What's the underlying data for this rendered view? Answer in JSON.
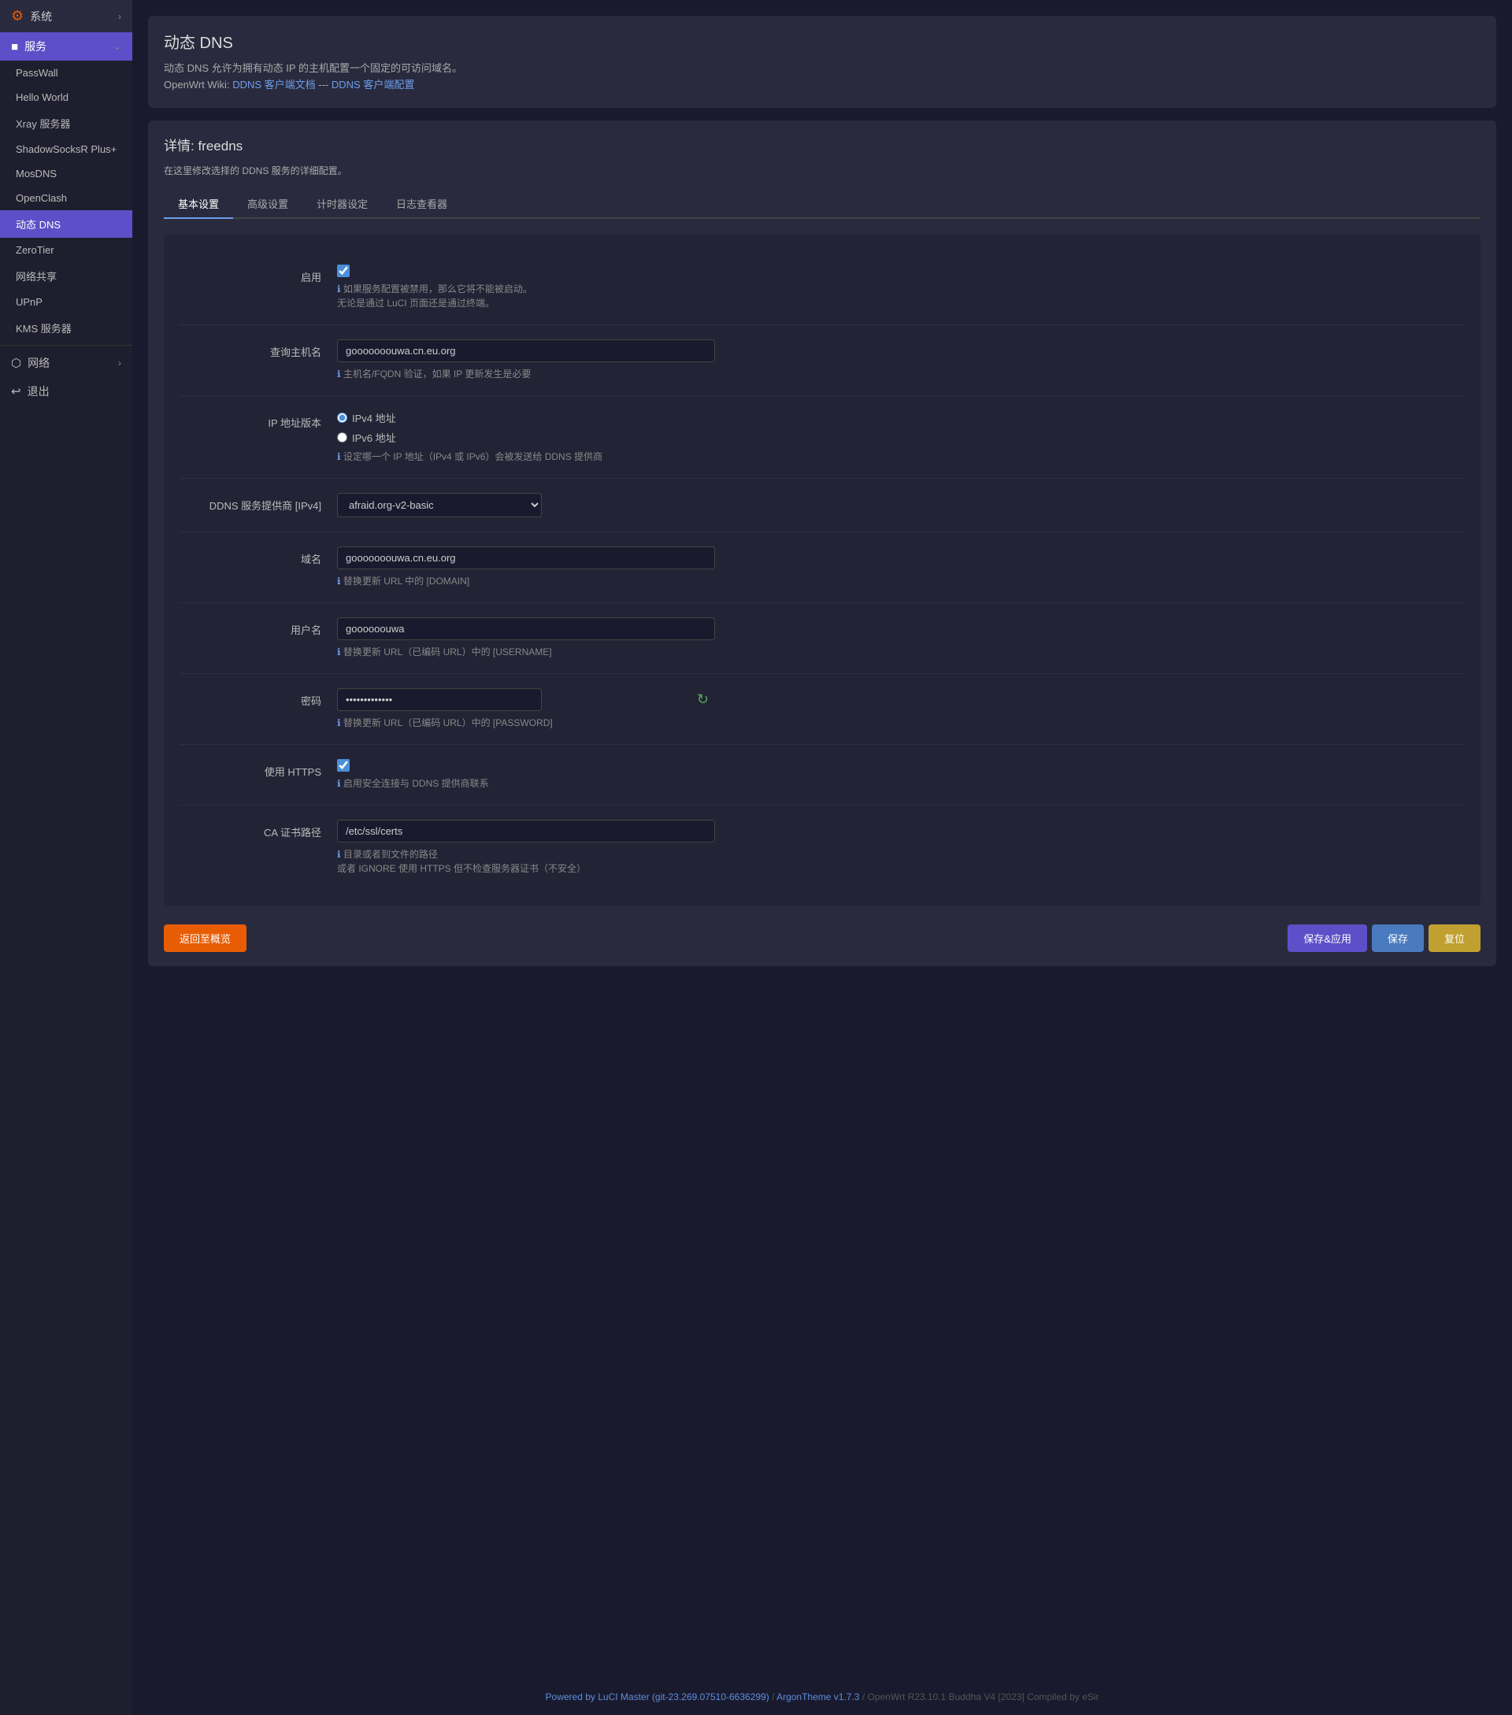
{
  "sidebar": {
    "system_label": "系统",
    "services_label": "服务",
    "network_label": "网络",
    "logout_label": "退出",
    "items": [
      {
        "id": "passwall",
        "label": "PassWall"
      },
      {
        "id": "hello-world",
        "label": "Hello World"
      },
      {
        "id": "xray",
        "label": "Xray 服务器"
      },
      {
        "id": "shadowsocks",
        "label": "ShadowSocksR Plus+"
      },
      {
        "id": "mosdns",
        "label": "MosDNS"
      },
      {
        "id": "openclash",
        "label": "OpenClash"
      },
      {
        "id": "ddns",
        "label": "动态 DNS"
      },
      {
        "id": "zerotier",
        "label": "ZeroTier"
      },
      {
        "id": "network-share",
        "label": "网络共享"
      },
      {
        "id": "upnp",
        "label": "UPnP"
      },
      {
        "id": "kms",
        "label": "KMS 服务器"
      }
    ]
  },
  "page": {
    "title": "动态 DNS",
    "description_1": "动态 DNS 允许为拥有动态 IP 的主机配置一个固定的可访问域名。",
    "description_2": "OpenWrt Wiki:",
    "wiki_link_1": "DDNS 客户端文档",
    "wiki_separator": "---",
    "wiki_link_2": "DDNS 客户端配置",
    "details_title": "详情: freedns",
    "details_subtitle": "在这里修改选择的 DDNS 服务的详细配置。"
  },
  "tabs": [
    {
      "id": "basic",
      "label": "基本设置",
      "active": true
    },
    {
      "id": "advanced",
      "label": "高级设置",
      "active": false
    },
    {
      "id": "timer",
      "label": "计时器设定",
      "active": false
    },
    {
      "id": "logs",
      "label": "日志查看器",
      "active": false
    }
  ],
  "form": {
    "enable_label": "启用",
    "enable_hint_1": "如果服务配置被禁用，那么它将不能被启动。",
    "enable_hint_2": "无论是通过 LuCI 页面还是通过终端。",
    "hostname_label": "查询主机名",
    "hostname_value": "gooooooouwa.cn.eu.org",
    "hostname_hint": "主机名/FQDN 验证，如果 IP 更新发生是必要",
    "ip_version_label": "IP 地址版本",
    "ip_v4_label": "IPv4 地址",
    "ip_v6_label": "IPv6 地址",
    "ip_hint": "设定哪一个 IP 地址（IPv4 或 IPv6）会被发送给 DDNS 提供商",
    "ddns_provider_label": "DDNS 服务提供商 [IPv4]",
    "ddns_provider_value": "afraid.org-v2-basic",
    "domain_label": "域名",
    "domain_value": "gooooooouwa.cn.eu.org",
    "domain_hint": "替换更新 URL 中的 [DOMAIN]",
    "username_label": "用户名",
    "username_value": "goooooouwa",
    "username_hint": "替换更新 URL（已编码 URL）中的 [USERNAME]",
    "password_label": "密码",
    "password_value": "•••••••••••••",
    "password_hint": "替换更新 URL（已编码 URL）中的 [PASSWORD]",
    "https_label": "使用 HTTPS",
    "https_hint": "启用安全连接与 DDNS 提供商联系",
    "ca_cert_label": "CA 证书路径",
    "ca_cert_value": "/etc/ssl/certs",
    "ca_cert_hint_1": "目录或者到文件的路径",
    "ca_cert_hint_2": "或者 IGNORE 使用 HTTPS 但不检查服务器证书（不安全）"
  },
  "buttons": {
    "back_label": "返回至概览",
    "save_apply_label": "保存&应用",
    "save_label": "保存",
    "reset_label": "复位"
  },
  "footer": {
    "powered_by": "Powered by LuCI Master (git-23.269.07510-6636299)",
    "theme": "ArgonTheme v1.7.3",
    "system_info": "/ OpenWrt R23.10.1 Buddha V4 [2023] Compiled by eSir"
  }
}
